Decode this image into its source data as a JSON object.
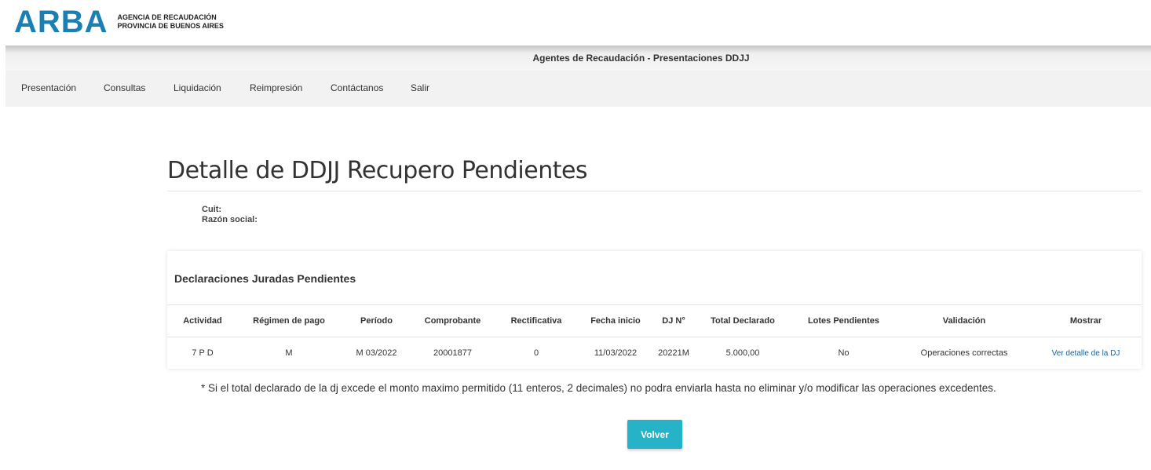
{
  "logo": {
    "mark": "ARBA",
    "line1": "AGENCIA DE RECAUDACIÓN",
    "line2": "PROVINCIA DE BUENOS AIRES"
  },
  "header": {
    "title": "Agentes de Recaudación - Presentaciones DDJJ"
  },
  "nav": [
    "Presentación",
    "Consultas",
    "Liquidación",
    "Reimpresión",
    "Contáctanos",
    "Salir"
  ],
  "page": {
    "title": "Detalle de DDJJ Recupero Pendientes",
    "cuit_label": "Cuit:",
    "razon_label": "Razón social:"
  },
  "card": {
    "title": "Declaraciones Juradas Pendientes",
    "columns": [
      "Actividad",
      "Régimen de pago",
      "Período",
      "Comprobante",
      "Rectificativa",
      "Fecha inicio",
      "DJ N°",
      "Total Declarado",
      "Lotes Pendientes",
      "Validación",
      "Mostrar"
    ],
    "rows": [
      [
        "7 P D",
        "M",
        "M 03/2022",
        "20001877",
        "0",
        "11/03/2022",
        "20221M",
        "5.000,00",
        "No",
        "Operaciones correctas",
        "Ver detalle de la DJ"
      ]
    ]
  },
  "note": "*  Si el total declarado de la dj excede el monto maximo permitido (11 enteros, 2 decimales) no podra enviarla hasta no eliminar y/o modificar las operaciones excedentes.",
  "button": {
    "label": "Volver",
    "color": "#26b3c8"
  },
  "colors": {
    "brand": "#1c7fb3",
    "link": "#1a6496"
  }
}
